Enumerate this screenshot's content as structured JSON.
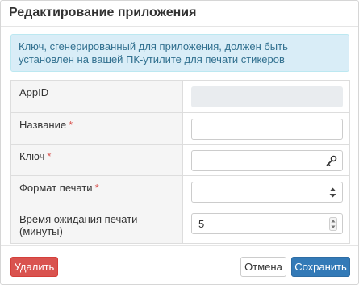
{
  "dialog": {
    "title": "Редактирование приложения"
  },
  "alert": {
    "text": "Ключ, сгенерированный для приложения, должен быть установлен на вашей ПК-утилите для печати стикеров"
  },
  "form": {
    "rows": [
      {
        "label": "AppID",
        "required": false,
        "value": ""
      },
      {
        "label": "Название",
        "required": true,
        "value": ""
      },
      {
        "label": "Ключ",
        "required": true,
        "value": ""
      },
      {
        "label": "Формат печати",
        "required": true,
        "value": ""
      },
      {
        "label": "Время ожидания печати (минуты)",
        "required": false,
        "value": "5"
      }
    ],
    "required_mark": "*"
  },
  "footer": {
    "delete_label": "Удалить",
    "cancel_label": "Отмена",
    "save_label": "Сохранить"
  },
  "colors": {
    "primary": "#337ab7",
    "danger": "#d9534f",
    "info_bg": "#d9edf7",
    "info_text": "#31708f",
    "required": "#d9534f"
  },
  "icons": {
    "key_field": "key-icon",
    "select": "select-arrows-icon",
    "number": "stepper-icon"
  }
}
